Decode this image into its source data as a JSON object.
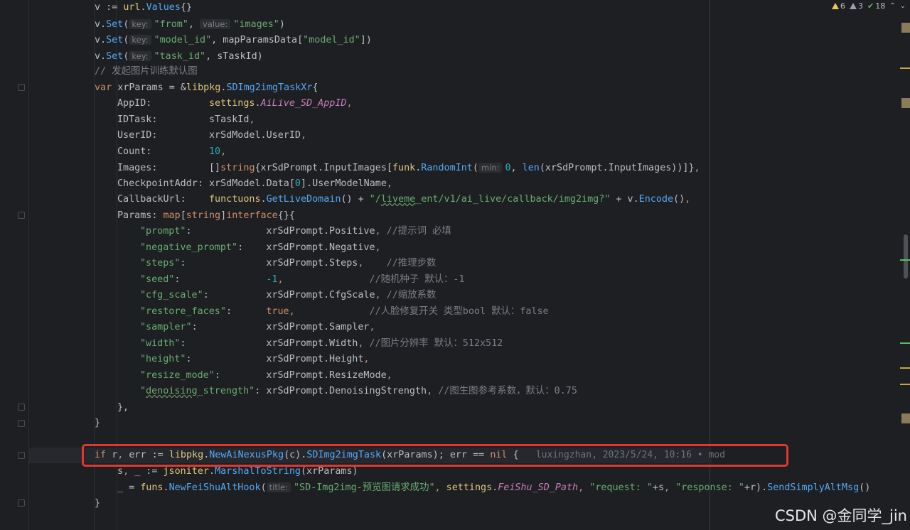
{
  "status": {
    "warnings": "6",
    "weak_warnings": "3",
    "ok": "18"
  },
  "lines": [
    {
      "indent": 0,
      "html": [
        [
          "",
          "v := "
        ],
        [
          "pkg",
          "url"
        ],
        [
          "",
          "."
        ],
        [
          "fn",
          "Values"
        ],
        [
          "",
          "{}"
        ]
      ]
    },
    {
      "indent": 0,
      "html": [
        [
          "",
          "v."
        ],
        [
          "fn",
          "Set"
        ],
        [
          "",
          "("
        ],
        [
          "hint",
          "key:"
        ],
        [
          "str",
          "\"from\""
        ],
        [
          "",
          ", "
        ],
        [
          "hint",
          "value:"
        ],
        [
          "str",
          "\"images\""
        ],
        [
          "",
          ")"
        ]
      ]
    },
    {
      "indent": 0,
      "html": [
        [
          "",
          "v."
        ],
        [
          "fn",
          "Set"
        ],
        [
          "",
          "("
        ],
        [
          "hint",
          "key:"
        ],
        [
          "str",
          "\"model_id\""
        ],
        [
          "",
          ", mapParamsData["
        ],
        [
          "str",
          "\"model_id\""
        ],
        [
          "",
          "])"
        ]
      ]
    },
    {
      "indent": 0,
      "html": [
        [
          "",
          "v."
        ],
        [
          "fn",
          "Set"
        ],
        [
          "",
          "("
        ],
        [
          "hint",
          "key:"
        ],
        [
          "str",
          "\"task_id\""
        ],
        [
          "",
          ", sTaskId)"
        ]
      ]
    },
    {
      "indent": 0,
      "html": [
        [
          "cmt",
          "// 发起图片训练默认图"
        ]
      ]
    },
    {
      "indent": 0,
      "html": [
        [
          "kw",
          "var "
        ],
        [
          "",
          "xrParams = &"
        ],
        [
          "pkg",
          "libpkg"
        ],
        [
          "",
          "."
        ],
        [
          "fn",
          "SDImg2imgTaskXr"
        ],
        [
          "",
          "{"
        ]
      ]
    },
    {
      "indent": 1,
      "html": [
        [
          "",
          "AppID:          "
        ],
        [
          "pkg",
          "settings"
        ],
        [
          "",
          "."
        ],
        [
          "field",
          "AiLive_SD_AppID"
        ],
        [
          "kw",
          ","
        ]
      ]
    },
    {
      "indent": 1,
      "html": [
        [
          "",
          "IDTask:         sTaskId"
        ],
        [
          "kw",
          ","
        ]
      ]
    },
    {
      "indent": 1,
      "html": [
        [
          "",
          "UserID:         xrSdModel.UserID"
        ],
        [
          "kw",
          ","
        ]
      ]
    },
    {
      "indent": 1,
      "html": [
        [
          "",
          "Count:          "
        ],
        [
          "num",
          "10"
        ],
        [
          "kw",
          ","
        ]
      ]
    },
    {
      "indent": 1,
      "html": [
        [
          "",
          "Images:         []"
        ],
        [
          "typ",
          "string"
        ],
        [
          "",
          "{xrSdPrompt.InputImages["
        ],
        [
          "pkg",
          "funk"
        ],
        [
          "",
          "."
        ],
        [
          "fn",
          "RandomInt"
        ],
        [
          "",
          "("
        ],
        [
          "hint",
          "min:"
        ],
        [
          "num",
          "0"
        ],
        [
          "",
          ", "
        ],
        [
          "fn",
          "len"
        ],
        [
          "",
          "(xrSdPrompt.InputImages))]}"
        ],
        [
          "kw",
          ","
        ]
      ]
    },
    {
      "indent": 1,
      "html": [
        [
          "",
          "CheckpointAddr: xrSdModel.Data["
        ],
        [
          "num",
          "0"
        ],
        [
          "",
          "].UserModelName"
        ],
        [
          "kw",
          ","
        ]
      ]
    },
    {
      "indent": 1,
      "html": [
        [
          "",
          "CallbackUrl:    "
        ],
        [
          "pkg",
          "functuons"
        ],
        [
          "",
          "."
        ],
        [
          "fn",
          "GetLiveDomain"
        ],
        [
          "",
          "() + "
        ],
        [
          "str",
          "\"/"
        ],
        [
          "str squig",
          "liveme"
        ],
        [
          "str",
          "_ent/v1/ai_live/callback/img2img?\""
        ],
        [
          "",
          " + v."
        ],
        [
          "fn",
          "Encode"
        ],
        [
          "",
          "()"
        ],
        [
          "kw",
          ","
        ]
      ]
    },
    {
      "indent": 1,
      "html": [
        [
          "",
          "Params: "
        ],
        [
          "typ",
          "map"
        ],
        [
          "",
          "["
        ],
        [
          "typ",
          "string"
        ],
        [
          "",
          "]"
        ],
        [
          "typ",
          "interface"
        ],
        [
          "",
          "{}{"
        ]
      ]
    },
    {
      "indent": 2,
      "html": [
        [
          "str",
          "\"prompt\""
        ],
        [
          "",
          ":             xrSdPrompt.Positive"
        ],
        [
          "kw",
          ", "
        ],
        [
          "cmt",
          "//提示词 必填"
        ]
      ]
    },
    {
      "indent": 2,
      "html": [
        [
          "str",
          "\"negative_prompt\""
        ],
        [
          "",
          ":    xrSdPrompt.Negative"
        ],
        [
          "kw",
          ","
        ]
      ]
    },
    {
      "indent": 2,
      "html": [
        [
          "str",
          "\"steps\""
        ],
        [
          "",
          ":              xrSdPrompt.Steps"
        ],
        [
          "kw",
          ",    "
        ],
        [
          "cmt",
          "//推理步数"
        ]
      ]
    },
    {
      "indent": 2,
      "html": [
        [
          "str",
          "\"seed\""
        ],
        [
          "",
          ":               "
        ],
        [
          "num",
          "-1"
        ],
        [
          "kw",
          ",               "
        ],
        [
          "cmt",
          "//随机种子 默认：-1"
        ]
      ]
    },
    {
      "indent": 2,
      "html": [
        [
          "str",
          "\"cfg_scale\""
        ],
        [
          "",
          ":          xrSdPrompt.CfgScale"
        ],
        [
          "kw",
          ", "
        ],
        [
          "cmt",
          "//缩放系数"
        ]
      ]
    },
    {
      "indent": 2,
      "html": [
        [
          "str",
          "\"restore_faces\""
        ],
        [
          "",
          ":      "
        ],
        [
          "kw",
          "true"
        ],
        [
          "kw",
          ",             "
        ],
        [
          "cmt",
          "//人脸修复开关 类型bool 默认：false"
        ]
      ]
    },
    {
      "indent": 2,
      "html": [
        [
          "str",
          "\"sampler\""
        ],
        [
          "",
          ":            xrSdPrompt.Sampler"
        ],
        [
          "kw",
          ","
        ]
      ]
    },
    {
      "indent": 2,
      "html": [
        [
          "str",
          "\"width\""
        ],
        [
          "",
          ":              xrSdPrompt.Width"
        ],
        [
          "kw",
          ", "
        ],
        [
          "cmt",
          "//图片分辨率 默认：512x512"
        ]
      ]
    },
    {
      "indent": 2,
      "html": [
        [
          "str",
          "\"height\""
        ],
        [
          "",
          ":             xrSdPrompt.Height"
        ],
        [
          "kw",
          ","
        ]
      ]
    },
    {
      "indent": 2,
      "html": [
        [
          "str",
          "\"resize_mode\""
        ],
        [
          "",
          ":        xrSdPrompt.ResizeMode"
        ],
        [
          "kw",
          ","
        ]
      ]
    },
    {
      "indent": 2,
      "html": [
        [
          "str",
          "\""
        ],
        [
          "str squig",
          "denoising"
        ],
        [
          "str",
          "_strength\""
        ],
        [
          "",
          ": xrSdPrompt.DenoisingStrength"
        ],
        [
          "kw",
          ", "
        ],
        [
          "cmt",
          "//图生图参考系数，默认：0.75"
        ]
      ]
    },
    {
      "indent": 1,
      "html": [
        [
          "",
          "},"
        ]
      ]
    },
    {
      "indent": 0,
      "html": [
        [
          "",
          "}"
        ]
      ]
    },
    {
      "indent": 0,
      "html": []
    },
    {
      "indent": 0,
      "html": [
        [
          "kw",
          "if "
        ],
        [
          "",
          "r"
        ],
        [
          "kw",
          ", "
        ],
        [
          "",
          "err := "
        ],
        [
          "pkg",
          "libpkg"
        ],
        [
          "",
          "."
        ],
        [
          "fn",
          "NewAiNexusPkg"
        ],
        [
          "",
          "(c)."
        ],
        [
          "fn",
          "SDImg2imgTask"
        ],
        [
          "",
          "(xrParams); err == "
        ],
        [
          "kw",
          "nil "
        ],
        [
          "",
          "{   "
        ],
        [
          "blame",
          "luxingzhan, 2023/5/24, 10:16 • mod"
        ]
      ]
    },
    {
      "indent": 1,
      "html": [
        [
          "",
          "s"
        ],
        [
          "kw",
          ", "
        ],
        [
          "",
          "_ := "
        ],
        [
          "pkg",
          "jsoniter"
        ],
        [
          "",
          "."
        ],
        [
          "fn",
          "MarshalToString"
        ],
        [
          "",
          "(xrParams)"
        ]
      ]
    },
    {
      "indent": 1,
      "html": [
        [
          "",
          "_ = "
        ],
        [
          "pkg",
          "funs"
        ],
        [
          "",
          "."
        ],
        [
          "fn",
          "NewFeiShuAltHook"
        ],
        [
          "",
          "("
        ],
        [
          "hint",
          "title:"
        ],
        [
          "str",
          "\"SD-Img2img-预览图请求成功\""
        ],
        [
          "kw",
          ", "
        ],
        [
          "pkg",
          "settings"
        ],
        [
          "",
          "."
        ],
        [
          "field",
          "FeiShu_SD_Path"
        ],
        [
          "kw",
          ", "
        ],
        [
          "str",
          "\"request: \""
        ],
        [
          "",
          "+s"
        ],
        [
          "kw",
          ", "
        ],
        [
          "str",
          "\"response: \""
        ],
        [
          "",
          "+r)."
        ],
        [
          "fn",
          "SendSimplyAltMsg"
        ],
        [
          "",
          "()"
        ]
      ]
    },
    {
      "indent": 0,
      "html": [
        [
          "",
          "}"
        ]
      ]
    }
  ],
  "watermark": "CSDN @金同学_jin"
}
